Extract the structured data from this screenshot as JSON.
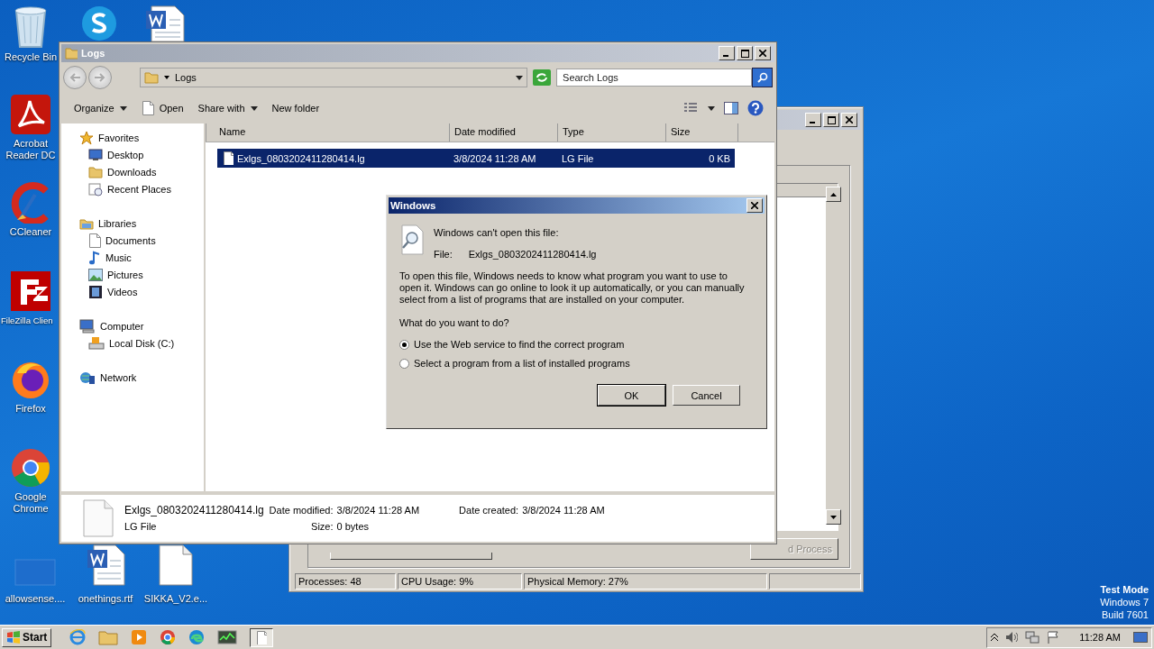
{
  "desktop_icons": [
    {
      "label": "Recycle Bin"
    },
    {
      "label": "Acrobat Reader DC"
    },
    {
      "label": "CCleaner"
    },
    {
      "label": "FileZilla Clien"
    },
    {
      "label": "Firefox"
    },
    {
      "label": "Google Chrome"
    }
  ],
  "bottom_icons": [
    {
      "label": "allowsense...."
    },
    {
      "label": "onethings.rtf"
    },
    {
      "label": "SIKKA_V2.e..."
    }
  ],
  "task_manager": {
    "button": "d Process",
    "status": [
      "Processes: 48",
      "CPU Usage: 9%",
      "Physical Memory: 27%"
    ]
  },
  "explorer": {
    "title": "Logs",
    "breadcrumb": "Logs",
    "search": {
      "placeholder": "Search Logs"
    },
    "toolbar": [
      {
        "label": "Organize",
        "kind": "menu"
      },
      {
        "label": "Open",
        "kind": "open"
      },
      {
        "label": "Share with",
        "kind": "menu"
      },
      {
        "label": "New folder",
        "kind": "plain"
      }
    ],
    "nav": [
      {
        "label": "Favorites",
        "children": [
          {
            "label": "Desktop"
          },
          {
            "label": "Downloads"
          },
          {
            "label": "Recent Places"
          }
        ]
      },
      {
        "label": "Libraries",
        "children": [
          {
            "label": "Documents"
          },
          {
            "label": "Music"
          },
          {
            "label": "Pictures"
          },
          {
            "label": "Videos"
          }
        ]
      },
      {
        "label": "Computer",
        "children": [
          {
            "label": "Local Disk (C:)"
          }
        ]
      },
      {
        "label": "Network"
      }
    ],
    "columns": [
      "Name",
      "Date modified",
      "Type",
      "Size"
    ],
    "rows": [
      {
        "name": "Exlgs_0803202411280414.lg",
        "date": "3/8/2024 11:28 AM",
        "type": "LG File",
        "size": "0 KB",
        "selected": true
      }
    ],
    "details": {
      "name": "Exlgs_0803202411280414.lg",
      "type": "LG File",
      "fields": [
        {
          "label": "Date modified:",
          "value": "3/8/2024 11:28 AM"
        },
        {
          "label": "Size:",
          "value": "0 bytes"
        },
        {
          "label": "Date created:",
          "value": "3/8/2024 11:28 AM"
        }
      ]
    }
  },
  "dialog": {
    "title": "Windows",
    "heading": "Windows can't open this file:",
    "file_label": "File:",
    "file_name": "Exlgs_0803202411280414.lg",
    "message": "To open this file, Windows needs to know what program you want to use to open it. Windows can go online to look it up automatically, or you can manually select from a list of programs that are installed on your computer.",
    "question": "What do you want to do?",
    "options": [
      {
        "label": "Use the Web service to find the correct program",
        "selected": true
      },
      {
        "label": "Select a program from a list of installed programs",
        "selected": false
      }
    ],
    "buttons": [
      "OK",
      "Cancel"
    ]
  },
  "os_notice": [
    "Test Mode",
    "Windows 7",
    "Build 7601"
  ],
  "taskbar": {
    "start": "Start",
    "clock": "11:28 AM"
  }
}
